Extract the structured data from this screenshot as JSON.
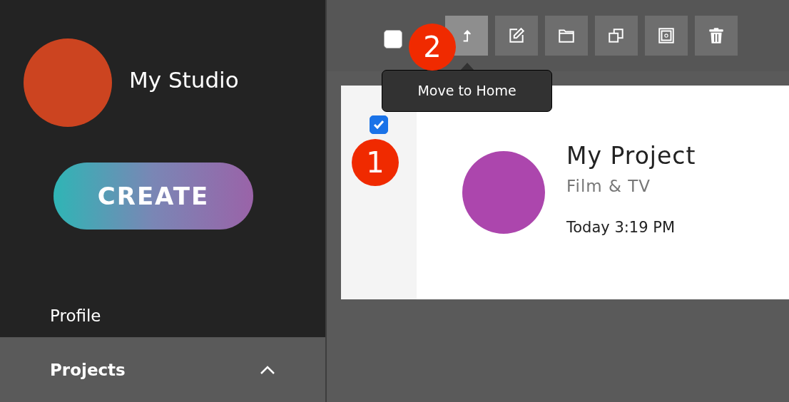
{
  "sidebar": {
    "studio_name": "My Studio",
    "create_button": "CREATE",
    "nav_items": [
      {
        "label": "Profile",
        "selected": false
      },
      {
        "label": "Projects",
        "selected": true,
        "expanded": true
      }
    ]
  },
  "toolbar": {
    "select_all": {
      "checked": false
    },
    "buttons": [
      {
        "kind": "move",
        "selected": true
      },
      {
        "kind": "edit",
        "selected": false
      },
      {
        "kind": "folder",
        "selected": false
      },
      {
        "kind": "duplicate",
        "selected": false
      },
      {
        "kind": "archive",
        "selected": false
      },
      {
        "kind": "delete",
        "selected": false
      }
    ],
    "tooltip": "Move to Home"
  },
  "callouts": [
    "1",
    "2"
  ],
  "projects": [
    {
      "title": "My Project",
      "category": "Film & TV",
      "time": "Today 3:19 PM",
      "checked": true
    }
  ]
}
